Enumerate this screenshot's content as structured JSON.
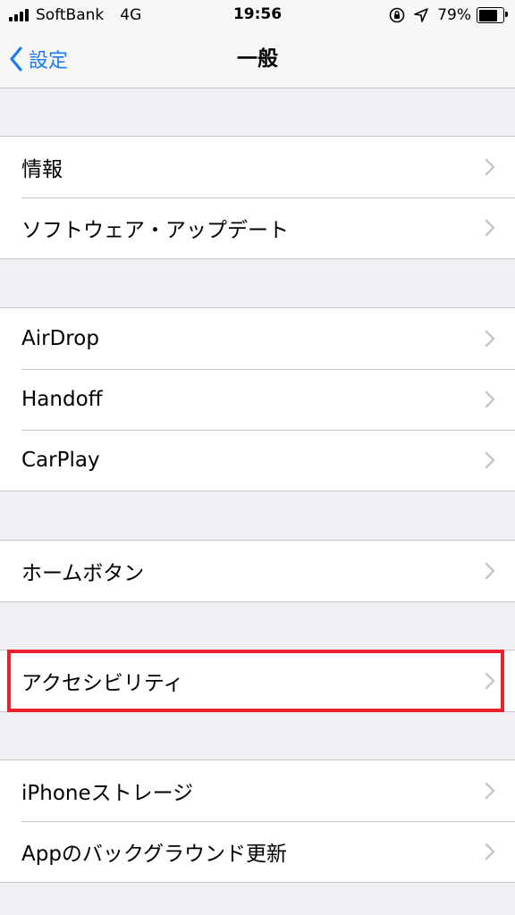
{
  "status_bar": {
    "carrier": "SoftBank",
    "network": "4G",
    "time": "19:56",
    "battery_percent": "79%",
    "battery_level": 0.79,
    "icons": [
      "signal-icon",
      "orientation-lock-icon",
      "location-arrow-icon",
      "battery-icon"
    ]
  },
  "nav": {
    "back_label": "設定",
    "title": "一般"
  },
  "groups": [
    {
      "items": [
        "情報",
        "ソフトウェア・アップデート"
      ]
    },
    {
      "items": [
        "AirDrop",
        "Handoff",
        "CarPlay"
      ]
    },
    {
      "items": [
        "ホームボタン"
      ]
    },
    {
      "items": [
        "アクセシビリティ"
      ],
      "highlighted": true
    },
    {
      "items": [
        "iPhoneストレージ",
        "Appのバックグラウンド更新"
      ]
    }
  ],
  "colors": {
    "accent": "#1a7cf5",
    "highlight": "#e8212d",
    "background": "#efeff4",
    "chevron": "#c4c4c9"
  }
}
